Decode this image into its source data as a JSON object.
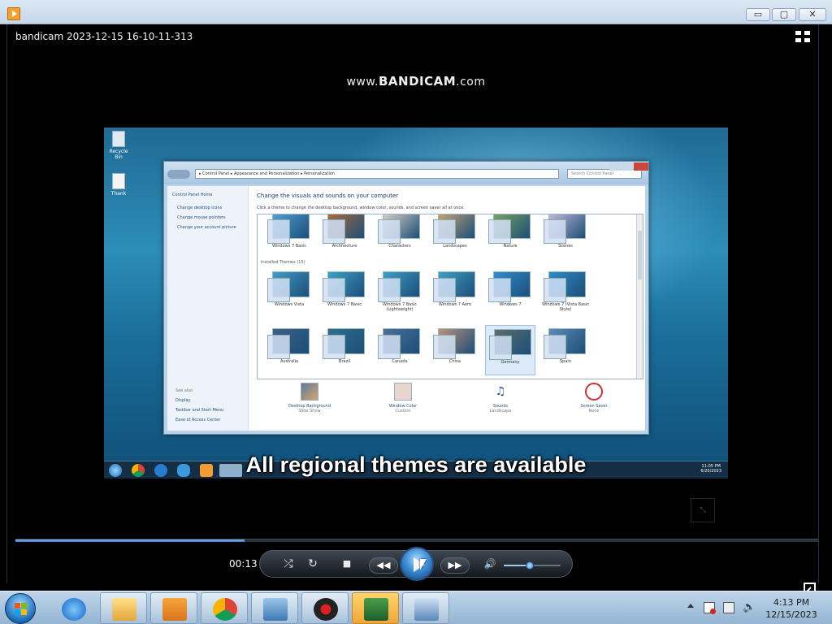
{
  "window": {
    "title": "bandicam 2023-12-15 16-10-11-313",
    "minimize": "▭",
    "maximize": "▢",
    "close": "✕"
  },
  "video": {
    "watermark_prefix": "www.",
    "watermark_brand": "BANDICAM",
    "watermark_suffix": ".com",
    "subtitle": "All regional themes are available",
    "desktop_icons": [
      "Recycle Bin",
      "Thank"
    ],
    "control_panel": {
      "breadcrumb": "▸ Control Panel ▸ Appearance and Personalization ▸ Personalization",
      "search_placeholder": "Search Control Panel",
      "heading": "Change the visuals and sounds on your computer",
      "instruction": "Click a theme to change the desktop background, window color, sounds, and screen saver all at once.",
      "left_links": [
        "Control Panel Home",
        "Change desktop icons",
        "Change mouse pointers",
        "Change your account picture"
      ],
      "see_also_title": "See also",
      "see_also": [
        "Display",
        "Taskbar and Start Menu",
        "Ease of Access Center"
      ],
      "section_label": "Installed Themes (15)",
      "themes_row1": [
        "Windows 7 Basic",
        "Architecture",
        "Characters",
        "Landscapes",
        "Nature",
        "Scenes"
      ],
      "themes_row2": [
        "Windows Vista",
        "Windows 7 Basic",
        "Windows 7 Basic (Lightweight)",
        "Windows 7 Aero",
        "Windows 7",
        "Windows 7 (Vista Basic Style)"
      ],
      "themes_row3": [
        "Australia",
        "Brazil",
        "Canada",
        "China",
        "Germany",
        "Spain"
      ],
      "selected_theme": "Germany",
      "bottom_items": [
        {
          "label": "Desktop Background",
          "sub": "Slide Show"
        },
        {
          "label": "Window Color",
          "sub": "Custom"
        },
        {
          "label": "Sounds",
          "sub": "Landscape"
        },
        {
          "label": "Screen Saver",
          "sub": "None"
        }
      ],
      "inner_clock_time": "11:05 PM",
      "inner_clock_date": "6/20/2023"
    }
  },
  "player": {
    "elapsed": "00:13",
    "progress": 0.285,
    "volume": 0.45,
    "buttons": {
      "shuffle": "⤮",
      "repeat": "↻",
      "stop": "■",
      "rewind": "◀◀",
      "forward": "▶▶",
      "volume": "🔊"
    }
  },
  "taskbar": {
    "items": [
      {
        "name": "Internet Explorer",
        "state": "pinned"
      },
      {
        "name": "Windows Explorer",
        "state": "open"
      },
      {
        "name": "Windows Media Player",
        "state": "open"
      },
      {
        "name": "Google Chrome",
        "state": "open"
      },
      {
        "name": "Control Panel",
        "state": "open"
      },
      {
        "name": "Bandicam",
        "state": "open"
      },
      {
        "name": "Remote Desktop",
        "state": "active"
      },
      {
        "name": "On-Screen Keyboard",
        "state": "open"
      }
    ],
    "clock_time": "4:13 PM",
    "clock_date": "12/15/2023"
  },
  "colors": {
    "accent_blue": "#3d8fd8",
    "seek_fill": "#3a7fd0",
    "active_taskbar": "#f0a638"
  }
}
